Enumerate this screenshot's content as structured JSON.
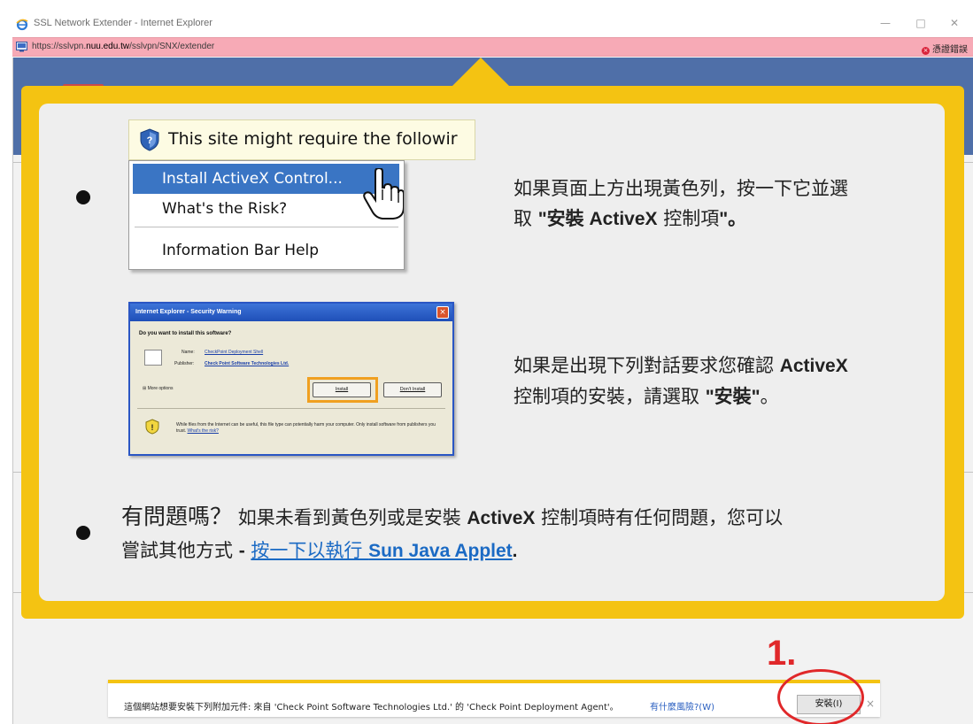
{
  "window": {
    "title": "SSL Network Extender - Internet Explorer",
    "minimize": "—",
    "maximize": "□",
    "close": "✕",
    "icon": "ie-icon"
  },
  "addressbar": {
    "url_prefix": "https://sslvpn.",
    "url_domain": "nuu.edu.tw",
    "url_path": "/sslvpn/SNX/extender",
    "cert_error": "憑證錯誤"
  },
  "help": {
    "illustration1": {
      "bar_text": "This site might require the followir",
      "menu": [
        "Install ActiveX Control...",
        "What's the Risk?",
        "Information Bar Help"
      ]
    },
    "step1_text_a": "如果頁面上方出現黃色列，按一下它並選",
    "step1_text_b_pre": "取 ",
    "step1_text_b_bold": "\"安裝 ActiveX",
    "step1_text_b_mid": " 控制項",
    "step1_text_b_end": "\"。",
    "illustration2": {
      "title": "Internet Explorer - Security Warning",
      "question": "Do you want to install this software?",
      "name_label": "Name:",
      "name_value": "CheckPoint Deployment Shell",
      "publisher_label": "Publisher:",
      "publisher_value": "Check Point Software Technologies Ltd.",
      "more_options": "More options",
      "install": "Install",
      "dont_install": "Don't Install",
      "warning": "While files from the Internet can be useful, this file type can potentially harm your computer. Only install software from publishers you trust.",
      "risk_link": "What's the risk?"
    },
    "step2_text_a": "如果是出現下列對話要求您確認 ",
    "step2_text_a_bold": "ActiveX",
    "step2_text_b_pre": "控制項的安裝，請選取 ",
    "step2_text_b_bold": "\"安裝\"",
    "step2_text_b_end": "。",
    "trouble_q": "有問題嗎？",
    "trouble_a": " 如果未看到黃色列或是安裝 ",
    "trouble_activex": "ActiveX",
    "trouble_b": " 控制項時有任何問題，您可以",
    "trouble_c": "嘗試其他方式 ",
    "trouble_dash": "-",
    "trouble_link_a": "按一下以執行 ",
    "trouble_link_b": "Sun Java Applet",
    "trouble_dot": "."
  },
  "annotation": {
    "step_number": "1."
  },
  "infobar": {
    "message": "這個網站想要安裝下列附加元件: 來自 'Check Point Software Technologies Ltd.' 的 'Check Point Deployment Agent'。",
    "risk_link": "有什麼風險?(W)",
    "install_button": "安裝(I)",
    "close": "×"
  },
  "colors": {
    "callout": "#f4c312",
    "annotation": "#e0282a",
    "link": "#1b6ac4"
  }
}
